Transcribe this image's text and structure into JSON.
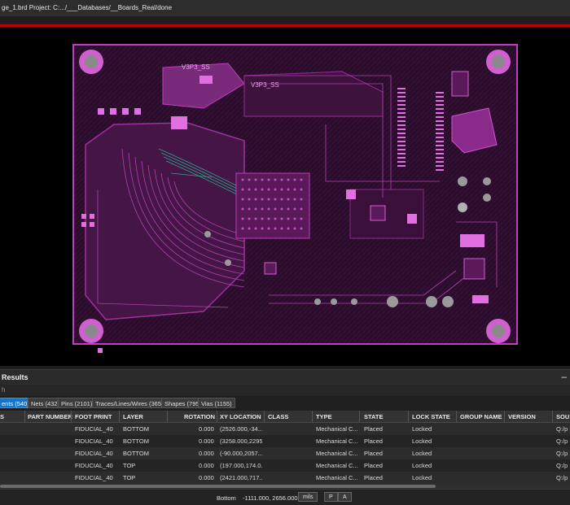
{
  "window": {
    "title": "ge_1.brd  Project: C:.../___Databases/__Boards_Real/done"
  },
  "board": {
    "silk_labels": [
      "V3P3_SS",
      "V3P3_SS"
    ],
    "colors": {
      "background": "#000000",
      "copper": "#c03cc0",
      "copper_dark": "#5a1a5a",
      "pad": "#e070e0",
      "hole": "#9a9a9a",
      "trace_alt": "#2aa88a",
      "highlight": "#c00000"
    }
  },
  "results": {
    "title": "Results",
    "search_placeholder": "h",
    "tabs": [
      "ents (540)",
      "Nets (432)",
      "Pins (2101)",
      "Traces/Lines/Wires (3655)",
      "Shapes (795)",
      "Vias (1155)"
    ],
    "columns": [
      "S",
      "PART NUMBER",
      "FOOT PRINT",
      "LAYER",
      "ROTATION",
      "XY LOCATION",
      "CLASS",
      "TYPE",
      "STATE",
      "LOCK STATE",
      "GROUP NAME",
      "VERSION",
      "SOU"
    ],
    "rows": [
      {
        "footprint": "FIDUCIAL_40",
        "layer": "BOTTOM",
        "rotation": "0.000",
        "xy": "(2526.000,-34....",
        "type": "Mechanical C...",
        "state": "Placed",
        "lock": "Locked",
        "source": "Q:/p"
      },
      {
        "footprint": "FIDUCIAL_40",
        "layer": "BOTTOM",
        "rotation": "0.000",
        "xy": "(3258.000,2295....",
        "type": "Mechanical C...",
        "state": "Placed",
        "lock": "Locked",
        "source": "Q:/p"
      },
      {
        "footprint": "FIDUCIAL_40",
        "layer": "BOTTOM",
        "rotation": "0.000",
        "xy": "(-90.000,2057....",
        "type": "Mechanical C...",
        "state": "Placed",
        "lock": "Locked",
        "source": "Q:/p"
      },
      {
        "footprint": "FIDUCIAL_40",
        "layer": "TOP",
        "rotation": "0.000",
        "xy": "(197.000,174.0....",
        "type": "Mechanical C...",
        "state": "Placed",
        "lock": "Locked",
        "source": "Q:/p"
      },
      {
        "footprint": "FIDUCIAL_40",
        "layer": "TOP",
        "rotation": "0.000",
        "xy": "(2421.000,717....",
        "type": "Mechanical C...",
        "state": "Placed",
        "lock": "Locked",
        "source": "Q:/p"
      }
    ]
  },
  "statusbar": {
    "layer": "Bottom",
    "coords": "-1111.000, 2656.000",
    "units": "mils",
    "btn_p": "P",
    "btn_a": "A"
  }
}
